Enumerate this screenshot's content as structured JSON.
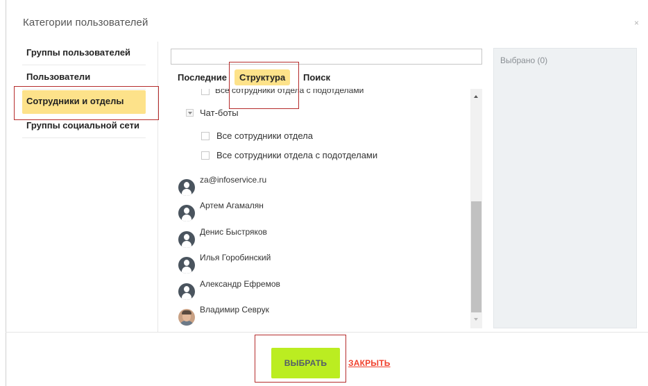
{
  "dialog": {
    "title": "Категории пользователей",
    "close_glyph": "×"
  },
  "categories": [
    {
      "label": "Группы пользователей",
      "active": false
    },
    {
      "label": "Пользователи",
      "active": false
    },
    {
      "label": "Сотрудники и отделы",
      "active": true
    },
    {
      "label": "Группы социальной сети",
      "active": false
    }
  ],
  "search": {
    "value": "",
    "placeholder": ""
  },
  "tabs": [
    {
      "label": "Последние",
      "active": false
    },
    {
      "label": "Структура",
      "active": true
    },
    {
      "label": "Поиск",
      "active": false
    }
  ],
  "tree": {
    "cut_off_row": "Все сотрудники отдела с подотделами",
    "department": "Чат-боты",
    "department_options": [
      "Все сотрудники отдела",
      "Все сотрудники отдела с подотделами"
    ],
    "users": [
      {
        "name": "za@infoservice.ru",
        "avatar": "person-icon"
      },
      {
        "name": "Артем Агамалян",
        "avatar": "person-icon"
      },
      {
        "name": "Денис Быстряков",
        "avatar": "person-icon"
      },
      {
        "name": "Илья Горобинский",
        "avatar": "person-icon"
      },
      {
        "name": "Александр Ефремов",
        "avatar": "person-icon"
      },
      {
        "name": "Владимир Севрук",
        "avatar": "photo"
      }
    ]
  },
  "selected": {
    "title": "Выбрано (0)"
  },
  "footer": {
    "select_label": "ВЫБРАТЬ",
    "close_label": "ЗАКРЫТЬ"
  },
  "colors": {
    "active_highlight": "#fde28a",
    "select_button": "#bbed21",
    "close_link": "#f0402c",
    "annotation_box": "#b52b2b"
  }
}
